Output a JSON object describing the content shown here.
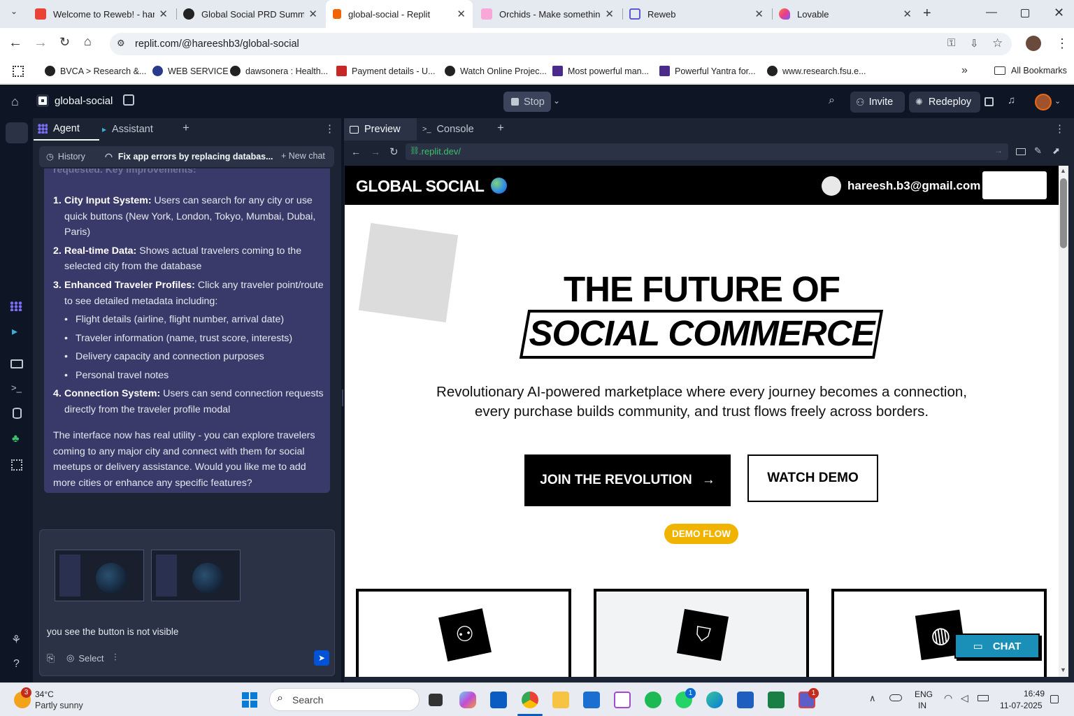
{
  "browser": {
    "tabs": [
      {
        "title": "Welcome to Reweb! - hare",
        "color": "#ea4335",
        "active": false
      },
      {
        "title": "Global Social PRD Summar",
        "color": "#222222",
        "active": false
      },
      {
        "title": "global-social - Replit",
        "color": "#f26207",
        "active": true
      },
      {
        "title": "Orchids - Make something",
        "color": "#f7a8d8",
        "active": false
      },
      {
        "title": "Reweb",
        "color": "#5b5bd6",
        "active": false
      },
      {
        "title": "Lovable",
        "color": "#ff5a5f",
        "active": false
      }
    ],
    "url": "replit.com/@hareeshb3/global-social",
    "bookmarks": [
      "BVCA > Research &...",
      "WEB SERVICE",
      "dawsonera : Health...",
      "Payment details - U...",
      "Watch Online Projec...",
      "Most powerful man...",
      "Powerful Yantra for...",
      "www.research.fsu.e..."
    ],
    "all_bookmarks": "All Bookmarks"
  },
  "replit": {
    "project_name": "global-social",
    "stop_label": "Stop",
    "invite_label": "Invite",
    "redeploy_label": "Redeploy",
    "left_tabs": {
      "agent": "Agent",
      "assistant": "Assistant"
    },
    "history_label": "History",
    "chat_title": "Fix app errors by replacing databas...",
    "new_chat_label": "New chat",
    "faded_text": "requested. Key improvements:",
    "list": [
      {
        "num": "1.",
        "bold": "City Input System:",
        "text": " Users can search for any city or use quick buttons (New York, London, Tokyo, Mumbai, Dubai, Paris)"
      },
      {
        "num": "2.",
        "bold": "Real-time Data:",
        "text": " Shows actual travelers coming to the selected city from the database"
      },
      {
        "num": "3.",
        "bold": "Enhanced Traveler Profiles:",
        "text": " Click any traveler point/route to see detailed metadata including:"
      }
    ],
    "sublist": [
      "Flight details (airline, flight number, arrival date)",
      "Traveler information (name, trust score, interests)",
      "Delivery capacity and connection purposes",
      "Personal travel notes"
    ],
    "item4": {
      "num": "4.",
      "bold": "Connection System:",
      "text": " Users can send connection requests directly from the traveler profile modal"
    },
    "closing": "The interface now has real utility - you can explore travelers coming to any major city and connect with them for social meetups or delivery assistance. Would you like me to add more cities or enhance any specific features?",
    "input_text": "you see the button is not visible",
    "select_label": "Select",
    "preview_tab": "Preview",
    "console_tab": "Console",
    "preview_url": ".replit.dev/"
  },
  "site": {
    "logo": "GLOBAL SOCIAL",
    "email": "hareesh.b3@gmail.com",
    "headline1": "THE FUTURE OF",
    "headline2": "SOCIAL COMMERCE",
    "sub1": "Revolutionary AI-powered marketplace where every journey becomes a connection,",
    "sub2": "every purchase builds community, and trust flows freely across borders.",
    "cta_primary": "JOIN THE REVOLUTION",
    "cta_secondary": "WATCH DEMO",
    "demo_badge": "DEMO FLOW",
    "chat_label": "CHAT",
    "colors": {
      "badge": "#f0b400",
      "chat": "#1a8fb8"
    }
  },
  "taskbar": {
    "weather_temp": "34°C",
    "weather_desc": "Partly sunny",
    "weather_badge": "3",
    "search_placeholder": "Search",
    "lang1": "ENG",
    "lang2": "IN",
    "time": "16:49",
    "date": "11-07-2025",
    "whatsapp_badge": "1",
    "teams_badge": "1"
  }
}
